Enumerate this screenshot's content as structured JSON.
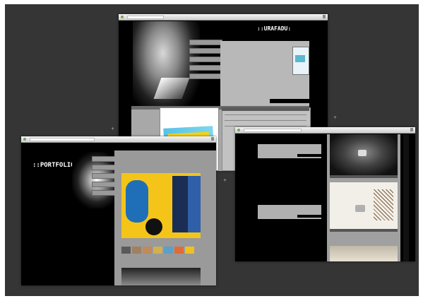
{
  "colors": {
    "desktop": "#353535",
    "window_bg": "#000000",
    "panel": "#b8b8b8",
    "button": "#9a9a9a",
    "accent_yellow": "#f4c518",
    "accent_blue": "#1f6fb8"
  },
  "window_top": {
    "logo": "::URAFADU:",
    "tagline": "",
    "nav": [
      "",
      "",
      "",
      "",
      ""
    ],
    "right_labels": [
      "",
      "",
      "",
      ""
    ],
    "poster_text": ""
  },
  "window_left": {
    "logo": "::PORTFOLIO",
    "nav": [
      "",
      "",
      "",
      "",
      ""
    ]
  },
  "window_right": {
    "play_icon": "play-icon"
  },
  "markers": [
    "+",
    "+",
    "+"
  ]
}
